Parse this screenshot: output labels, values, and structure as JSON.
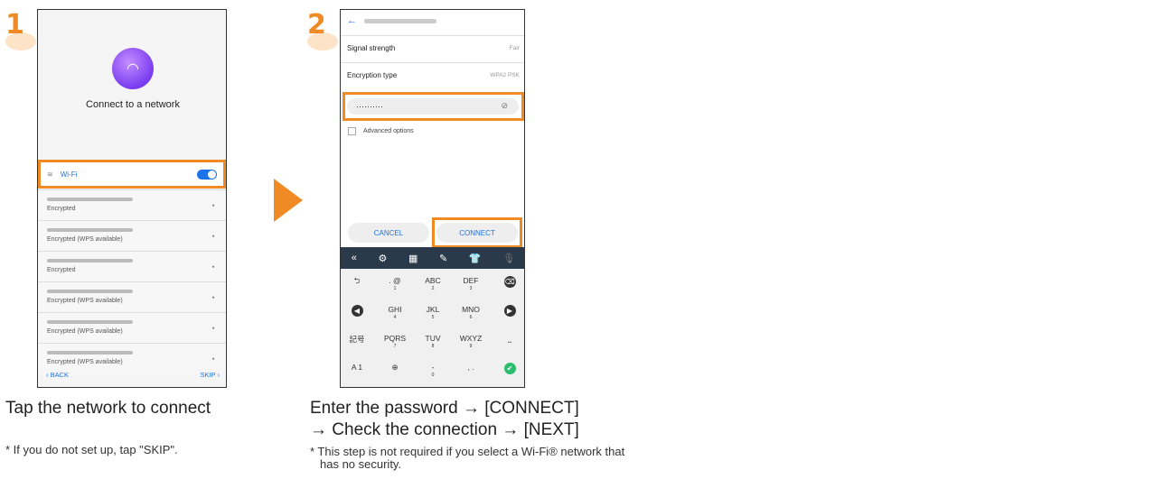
{
  "step1": {
    "number": "1",
    "title": "Connect to a network",
    "wifi_label": "Wi-Fi",
    "networks": [
      {
        "status": "Encrypted"
      },
      {
        "status": "Encrypted (WPS available)"
      },
      {
        "status": "Encrypted"
      },
      {
        "status": "Encrypted (WPS available)"
      },
      {
        "status": "Encrypted (WPS available)"
      },
      {
        "status": "Encrypted (WPS available)"
      }
    ],
    "back_label": "‹ BACK",
    "skip_label": "SKIP ›"
  },
  "step2": {
    "number": "2",
    "signal_label": "Signal strength",
    "signal_value": "Fair",
    "encryption_label": "Encryption type",
    "encryption_value": "WPA2 PSK",
    "password_value": "··········",
    "advanced_label": "Advanced options",
    "cancel_label": "CANCEL",
    "connect_label": "CONNECT"
  },
  "keyboard": {
    "rows": [
      [
        {
          "t": "⮌"
        },
        {
          "t": ". @",
          "s": "1"
        },
        {
          "t": "ABC",
          "s": "2"
        },
        {
          "t": "DEF",
          "s": "3"
        },
        {
          "t": "⌫"
        }
      ],
      [
        {
          "t": "◀"
        },
        {
          "t": "GHI",
          "s": "4"
        },
        {
          "t": "JKL",
          "s": "5"
        },
        {
          "t": "MNO",
          "s": "6"
        },
        {
          "t": "▶"
        }
      ],
      [
        {
          "t": "記号"
        },
        {
          "t": "PQRS",
          "s": "7"
        },
        {
          "t": "TUV",
          "s": "8"
        },
        {
          "t": "WXYZ",
          "s": "9"
        },
        {
          "t": "⎵"
        }
      ],
      [
        {
          "t": "A 1"
        },
        {
          "t": "⊕"
        },
        {
          "t": "-",
          "s": "0"
        },
        {
          "t": ", ."
        },
        {
          "t": "✔"
        }
      ]
    ]
  },
  "captions": {
    "step1_main": "Tap the network to connect",
    "step1_note": "* If you do not set up, tap \"SKIP\".",
    "step2_main_line1": "Enter the password → [CONNECT]",
    "step2_main_line2": "→ Check the connection → [NEXT]",
    "step2_note_line1": "* This step is not required if you select a Wi-Fi® network that",
    "step2_note_line2": "has no security."
  },
  "colors": {
    "accent": "#f08a24",
    "link": "#1a73e8"
  }
}
